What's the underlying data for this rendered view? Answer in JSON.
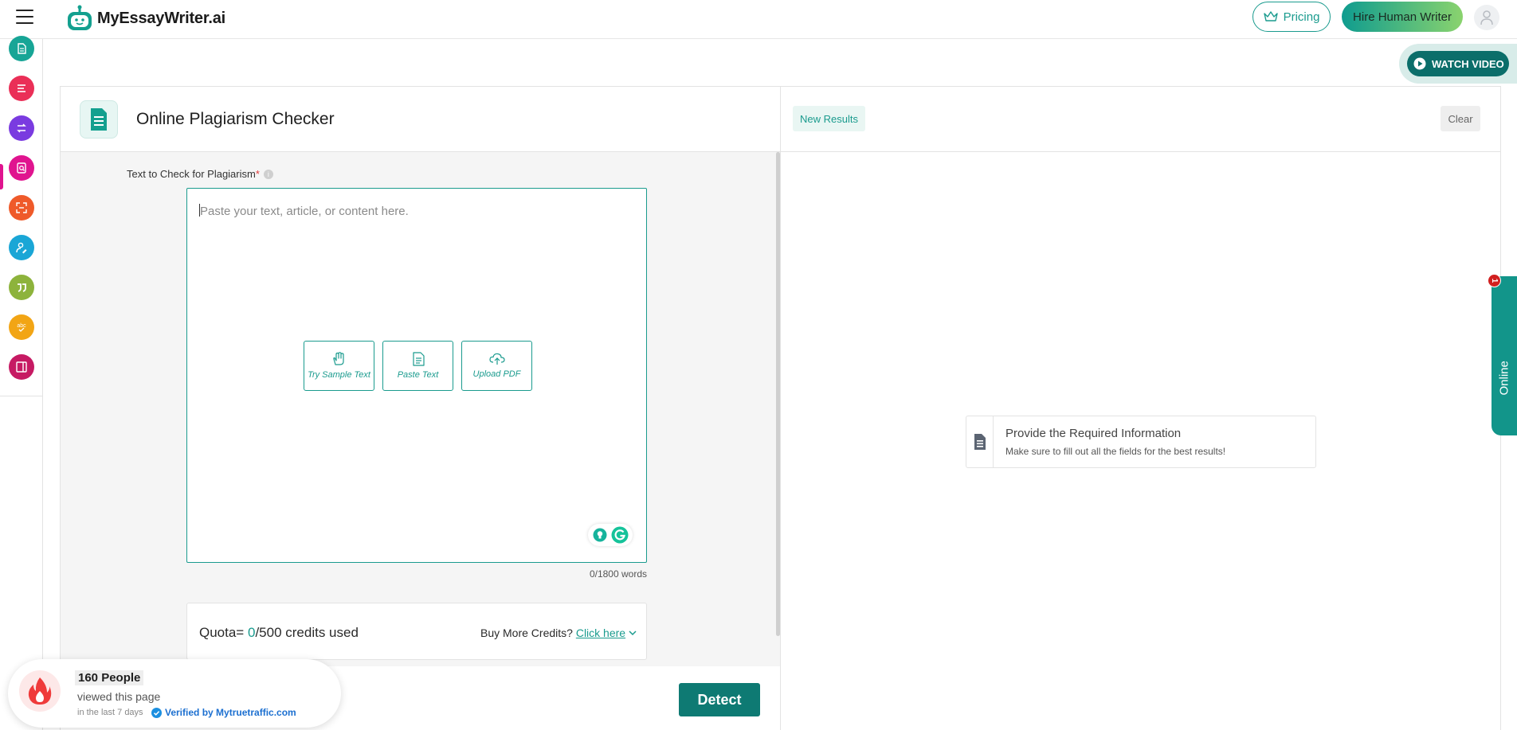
{
  "header": {
    "brand": "MyEssayWriter.ai",
    "pricing_label": "Pricing",
    "hire_label": "Hire Human Writer"
  },
  "sidebar": {
    "items": [
      {
        "name": "document-icon",
        "color": "#17a596"
      },
      {
        "name": "lines-icon",
        "color": "#ea2f57"
      },
      {
        "name": "paraphrase-icon",
        "color": "#7a3be0"
      },
      {
        "name": "plagiarism-icon",
        "color": "#e0148f",
        "active": true
      },
      {
        "name": "scan-icon",
        "color": "#ef5a2a"
      },
      {
        "name": "user-edit-icon",
        "color": "#1aa6d6"
      },
      {
        "name": "quote-icon",
        "color": "#8db33c"
      },
      {
        "name": "spellcheck-icon",
        "color": "#f2a515"
      },
      {
        "name": "book-icon",
        "color": "#c61a63"
      }
    ]
  },
  "watch_video": {
    "label": "WATCH VIDEO"
  },
  "tool": {
    "title": "Online Plagiarism Checker",
    "field_label": "Text to Check for Plagiarism",
    "required_mark": "*",
    "info_mark": "i",
    "placeholder": "Paste your text, article, or content here.",
    "actions": [
      {
        "label": "Try Sample Text",
        "icon": "hand-icon"
      },
      {
        "label": "Paste Text",
        "icon": "paste-icon"
      },
      {
        "label": "Upload PDF",
        "icon": "upload-cloud-icon"
      }
    ],
    "word_count": "0/1800 words",
    "quota": {
      "prefix": "Quota= ",
      "used": "0",
      "suffix": "/500 credits used"
    },
    "buy": {
      "prefix": "Buy More Credits? ",
      "link": "Click here"
    },
    "detect_label": "Detect"
  },
  "results": {
    "new_results_label": "New Results",
    "clear_label": "Clear",
    "card_title": "Provide the Required Information",
    "card_sub": "Make sure to fill out all the fields for the best results!"
  },
  "online_widget": {
    "label": "Online",
    "badge": "1"
  },
  "social_proof": {
    "people": "160 People",
    "viewed": "viewed this page",
    "period": "in the last 7 days",
    "verified": "Verified by Mytruetraffic.com"
  },
  "colors": {
    "accent": "#1a9b8e",
    "detect": "#0e7a73",
    "hire_gradient_start": "#0f9c8f",
    "hire_gradient_end": "#8ad36e"
  }
}
